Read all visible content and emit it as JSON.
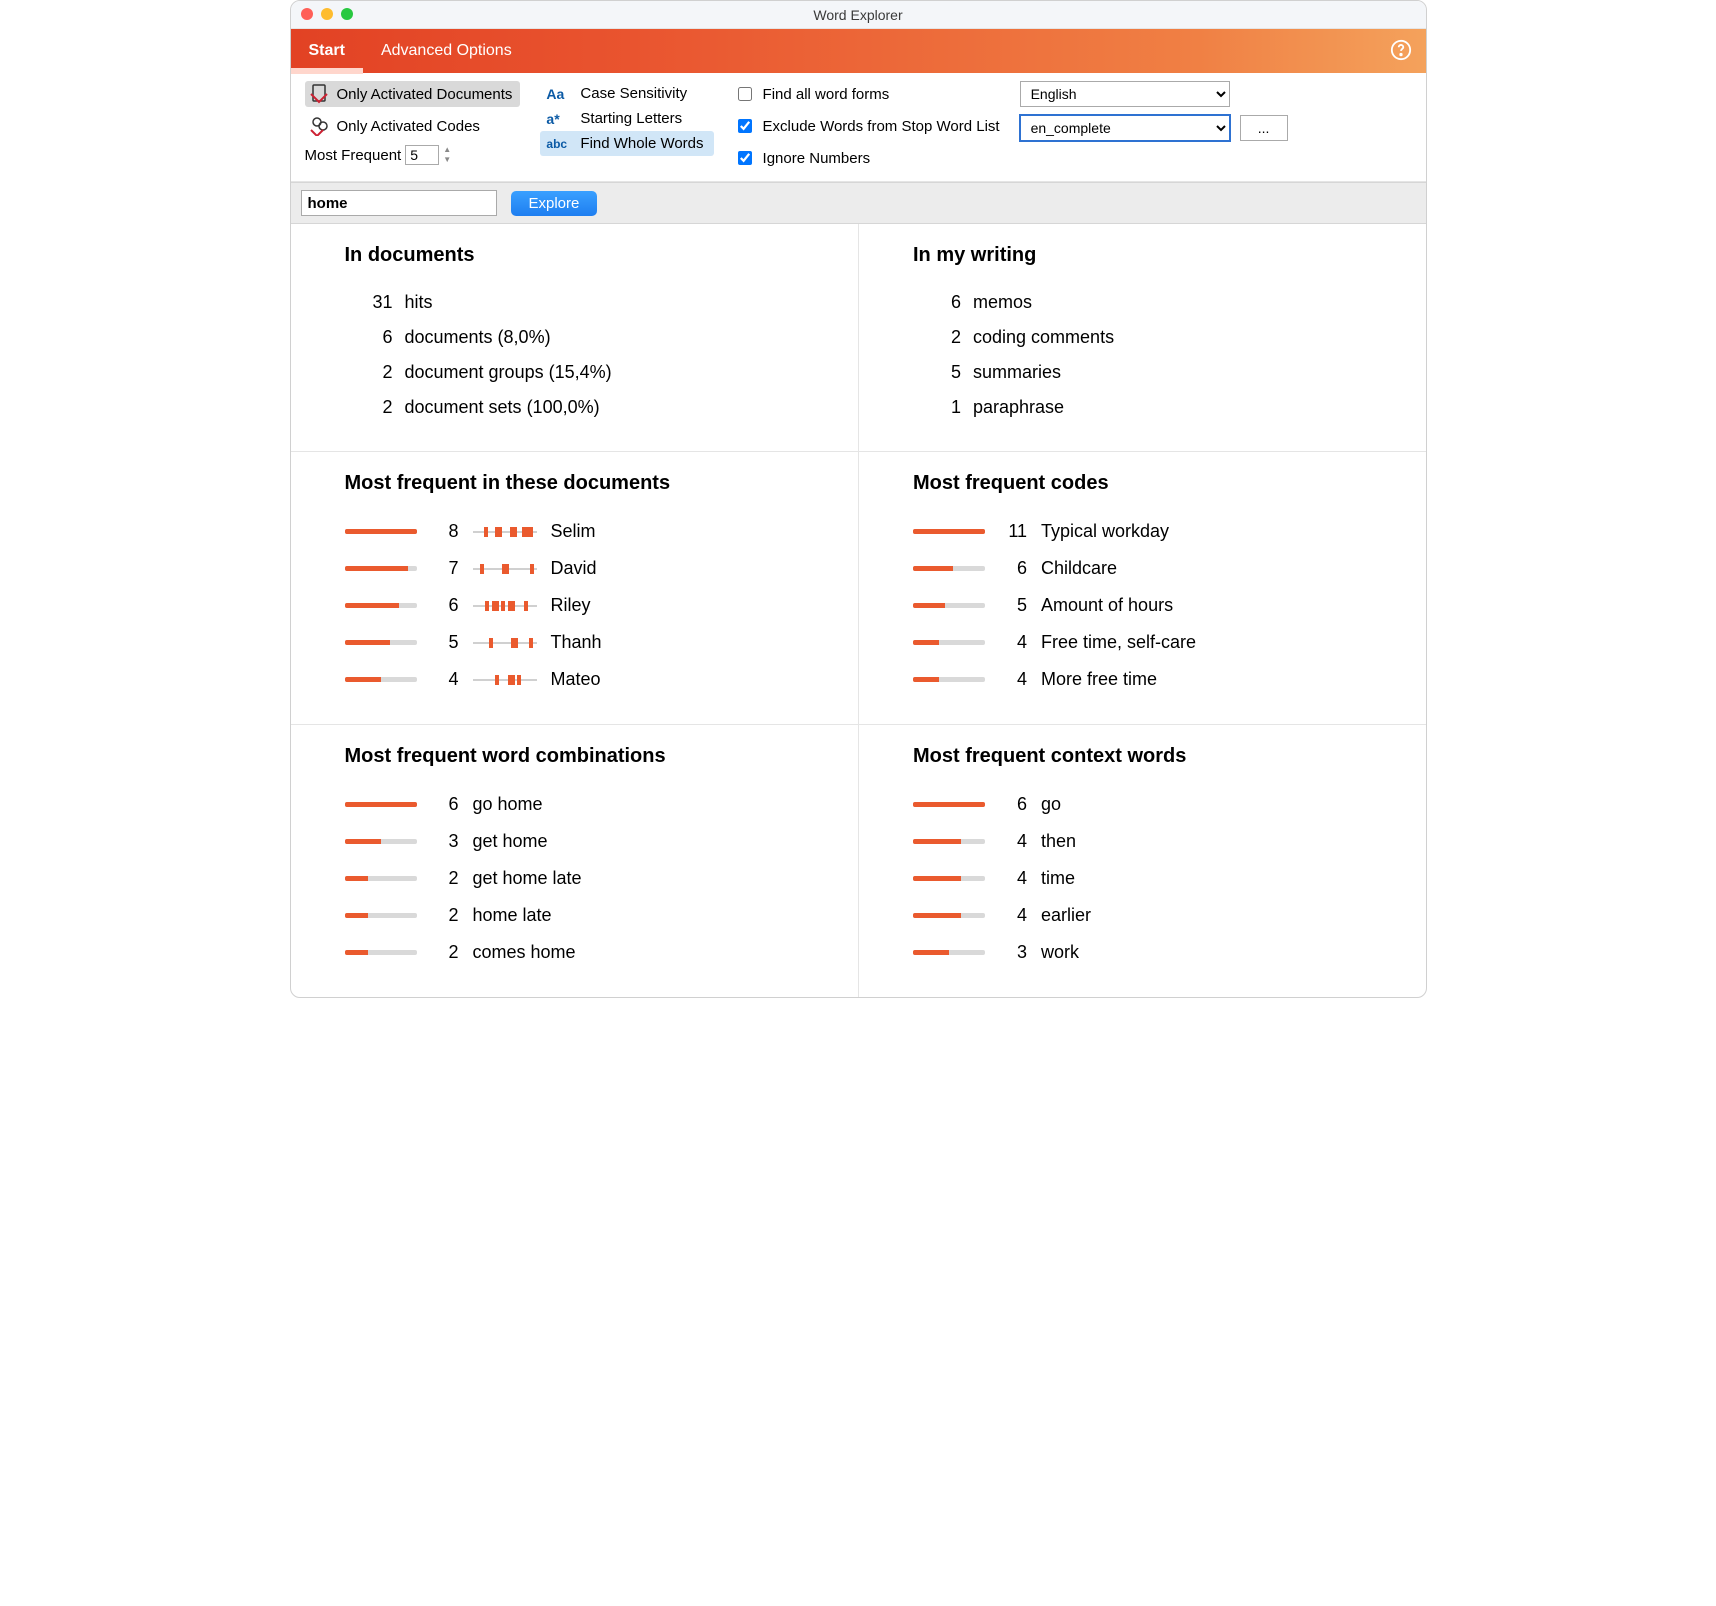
{
  "window": {
    "title": "Word Explorer"
  },
  "ribbon": {
    "tabs": [
      {
        "label": "Start",
        "active": true
      },
      {
        "label": "Advanced Options",
        "active": false
      }
    ]
  },
  "toolbar": {
    "only_activated_documents": "Only Activated Documents",
    "only_activated_codes": "Only Activated Codes",
    "most_frequent_label": "Most Frequent",
    "most_frequent_value": "5",
    "modes": [
      {
        "icon": "Aa",
        "label": "Case Sensitivity",
        "selected": false
      },
      {
        "icon": "a*",
        "label": "Starting Letters",
        "selected": false
      },
      {
        "icon": "abc",
        "label": "Find Whole Words",
        "selected": true
      }
    ],
    "checks": {
      "find_all_word_forms": {
        "label": "Find all word forms",
        "checked": false
      },
      "exclude_stop_list": {
        "label": "Exclude Words from Stop Word List",
        "checked": true
      },
      "ignore_numbers": {
        "label": "Ignore Numbers",
        "checked": true
      }
    },
    "language_select": "English",
    "stoplist_select": "en_complete",
    "dots_label": "..."
  },
  "search": {
    "value": "home",
    "explore_label": "Explore"
  },
  "panels": {
    "in_documents": {
      "title": "In documents",
      "rows": [
        {
          "n": "31",
          "label": "hits"
        },
        {
          "n": "6",
          "label": "documents (8,0%)"
        },
        {
          "n": "2",
          "label": "document groups (15,4%)"
        },
        {
          "n": "2",
          "label": "document sets (100,0%)"
        }
      ]
    },
    "in_my_writing": {
      "title": "In my writing",
      "rows": [
        {
          "n": "6",
          "label": "memos"
        },
        {
          "n": "2",
          "label": "coding comments"
        },
        {
          "n": "5",
          "label": "summaries"
        },
        {
          "n": "1",
          "label": "paraphrase"
        }
      ]
    },
    "most_freq_docs": {
      "title": "Most frequent in these documents",
      "rows": [
        {
          "n": "8",
          "label": "Selim",
          "fill": 100,
          "ticks": [
            18,
            35,
            40,
            58,
            78,
            84
          ]
        },
        {
          "n": "7",
          "label": "David",
          "fill": 88,
          "ticks": [
            12,
            46,
            90
          ]
        },
        {
          "n": "6",
          "label": "Riley",
          "fill": 75,
          "ticks": [
            20,
            30,
            45,
            55,
            80
          ]
        },
        {
          "n": "5",
          "label": "Thanh",
          "fill": 63,
          "ticks": [
            25,
            60,
            88
          ]
        },
        {
          "n": "4",
          "label": "Mateo",
          "fill": 50,
          "ticks": [
            35,
            55,
            70
          ]
        }
      ]
    },
    "most_freq_codes": {
      "title": "Most frequent codes",
      "rows": [
        {
          "n": "11",
          "label": "Typical workday",
          "fill": 100
        },
        {
          "n": "6",
          "label": "Childcare",
          "fill": 55
        },
        {
          "n": "5",
          "label": "Amount of hours",
          "fill": 45
        },
        {
          "n": "4",
          "label": "Free time, self-care",
          "fill": 36
        },
        {
          "n": "4",
          "label": "More free time",
          "fill": 36
        }
      ]
    },
    "most_freq_combos": {
      "title": "Most frequent word combinations",
      "rows": [
        {
          "n": "6",
          "label": "go home",
          "fill": 100
        },
        {
          "n": "3",
          "label": "get home",
          "fill": 50
        },
        {
          "n": "2",
          "label": "get home late",
          "fill": 33
        },
        {
          "n": "2",
          "label": "home late",
          "fill": 33
        },
        {
          "n": "2",
          "label": "comes home",
          "fill": 33
        }
      ]
    },
    "most_freq_context": {
      "title": "Most frequent context words",
      "rows": [
        {
          "n": "6",
          "label": "go",
          "fill": 100
        },
        {
          "n": "4",
          "label": "then",
          "fill": 67
        },
        {
          "n": "4",
          "label": "time",
          "fill": 67
        },
        {
          "n": "4",
          "label": "earlier",
          "fill": 67
        },
        {
          "n": "3",
          "label": "work",
          "fill": 50
        }
      ]
    }
  },
  "chart_data": [
    {
      "type": "bar",
      "title": "Most frequent in these documents",
      "categories": [
        "Selim",
        "David",
        "Riley",
        "Thanh",
        "Mateo"
      ],
      "values": [
        8,
        7,
        6,
        5,
        4
      ]
    },
    {
      "type": "bar",
      "title": "Most frequent codes",
      "categories": [
        "Typical workday",
        "Childcare",
        "Amount of hours",
        "Free time, self-care",
        "More free time"
      ],
      "values": [
        11,
        6,
        5,
        4,
        4
      ]
    },
    {
      "type": "bar",
      "title": "Most frequent word combinations",
      "categories": [
        "go home",
        "get home",
        "get home late",
        "home late",
        "comes home"
      ],
      "values": [
        6,
        3,
        2,
        2,
        2
      ]
    },
    {
      "type": "bar",
      "title": "Most frequent context words",
      "categories": [
        "go",
        "then",
        "time",
        "earlier",
        "work"
      ],
      "values": [
        6,
        4,
        4,
        4,
        3
      ]
    }
  ]
}
